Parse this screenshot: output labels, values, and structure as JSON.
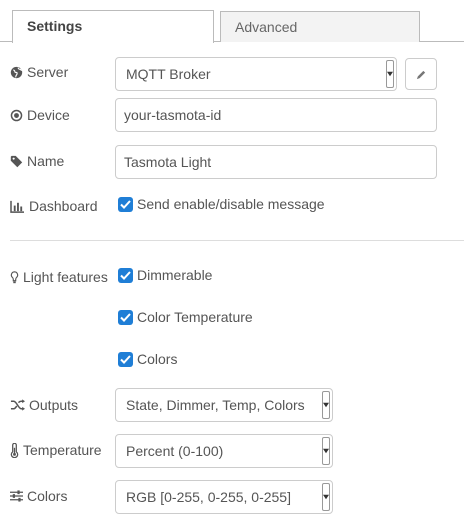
{
  "tabs": [
    {
      "label": "Settings",
      "active": true
    },
    {
      "label": "Advanced",
      "active": false
    }
  ],
  "server": {
    "label": "Server",
    "value": "MQTT Broker",
    "icon": "globe-icon"
  },
  "device": {
    "label": "Device",
    "value": "your-tasmota-id",
    "icon": "dot-circle-icon"
  },
  "name": {
    "label": "Name",
    "value": "Tasmota Light",
    "icon": "tag-icon"
  },
  "dashboard": {
    "label": "Dashboard",
    "checkbox_label": "Send enable/disable message",
    "checked": true,
    "icon": "bar-chart-icon"
  },
  "light_features": {
    "label": "Light features",
    "icon": "lightbulb-icon",
    "options": [
      {
        "label": "Dimmerable",
        "checked": true
      },
      {
        "label": "Color Temperature",
        "checked": true
      },
      {
        "label": "Colors",
        "checked": true
      }
    ]
  },
  "outputs": {
    "label": "Outputs",
    "value": "State, Dimmer, Temp, Colors",
    "icon": "random-icon"
  },
  "temperature": {
    "label": "Temperature",
    "value": "Percent (0-100)",
    "icon": "thermometer-icon"
  },
  "colors": {
    "label": "Colors",
    "value": "RGB [0-255, 0-255, 0-255]",
    "icon": "sliders-icon"
  },
  "theme": {
    "accent": "#1f7ed6",
    "border": "#cccccc",
    "text": "#555555"
  }
}
